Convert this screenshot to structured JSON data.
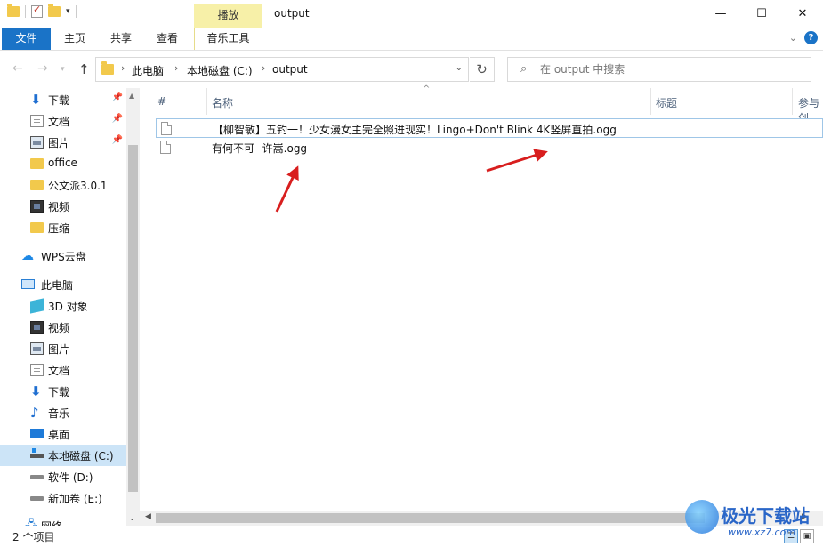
{
  "window": {
    "title": "output",
    "context_tab_label": "播放",
    "controls": {
      "minimize": "—",
      "maximize": "☐",
      "close": "✕"
    }
  },
  "ribbon": {
    "tabs": [
      "文件",
      "主页",
      "共享",
      "查看",
      "音乐工具"
    ],
    "help": "?"
  },
  "address": {
    "crumbs": [
      "此电脑",
      "本地磁盘 (C:)",
      "output"
    ],
    "refresh_icon": "↻"
  },
  "search": {
    "placeholder": "在 output 中搜索"
  },
  "sidebar": {
    "items": [
      {
        "label": "下载",
        "icon": "download-icon",
        "pinned": true
      },
      {
        "label": "文档",
        "icon": "document-icon",
        "pinned": true
      },
      {
        "label": "图片",
        "icon": "picture-icon",
        "pinned": true
      },
      {
        "label": "office",
        "icon": "folder-icon"
      },
      {
        "label": "公文派3.0.1",
        "icon": "folder-icon"
      },
      {
        "label": "视频",
        "icon": "video-icon"
      },
      {
        "label": "压缩",
        "icon": "folder-icon"
      },
      {
        "label": "WPS云盘",
        "icon": "cloud-icon"
      },
      {
        "label": "此电脑",
        "icon": "computer-icon"
      },
      {
        "label": "3D 对象",
        "icon": "3d-objects-icon"
      },
      {
        "label": "视频",
        "icon": "video-icon"
      },
      {
        "label": "图片",
        "icon": "picture-icon"
      },
      {
        "label": "文档",
        "icon": "document-icon"
      },
      {
        "label": "下载",
        "icon": "download-icon"
      },
      {
        "label": "音乐",
        "icon": "music-icon"
      },
      {
        "label": "桌面",
        "icon": "desktop-icon"
      },
      {
        "label": "本地磁盘 (C:)",
        "icon": "drive-c-icon",
        "selected": true
      },
      {
        "label": "软件 (D:)",
        "icon": "drive-icon"
      },
      {
        "label": "新加卷 (E:)",
        "icon": "drive-icon"
      },
      {
        "label": "网络",
        "icon": "network-icon"
      }
    ]
  },
  "file_list": {
    "columns": [
      "#",
      "名称",
      "标题",
      "参与创"
    ],
    "files": [
      {
        "name": "【柳智敏】五钓一！少女漫女主完全照进现实！Lingo+Don't Blink 4K竖屏直拍.ogg"
      },
      {
        "name": "有何不可--许嵩.ogg"
      }
    ]
  },
  "status": {
    "item_count": "2 个项目"
  },
  "watermark": {
    "text": "极光下载站",
    "url": "www.xz7.com"
  },
  "colors": {
    "accent": "#1a73c7",
    "context_tab": "#f7f0a8",
    "selection": "#cce4f7",
    "annotation_arrow": "#d81e1e"
  }
}
